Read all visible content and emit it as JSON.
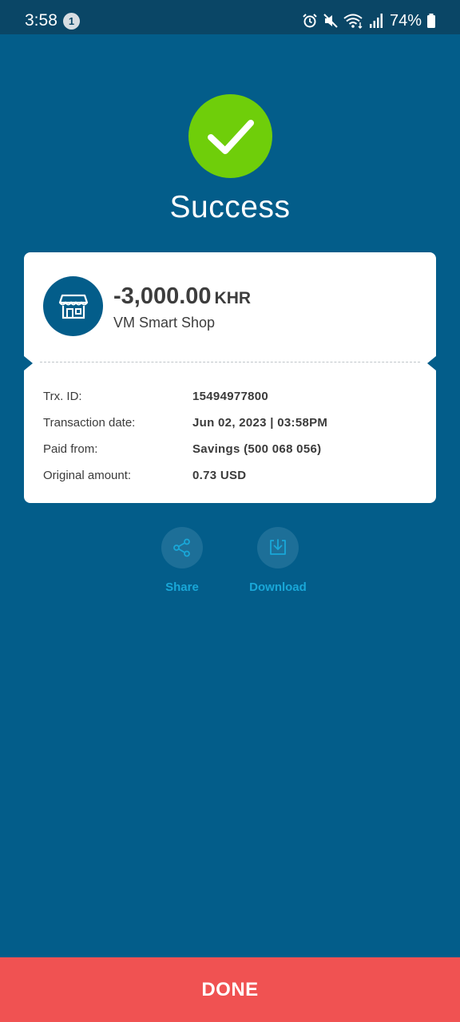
{
  "status_bar": {
    "time": "3:58",
    "notification_count": "1",
    "battery": "74%"
  },
  "result": {
    "title": "Success"
  },
  "transaction": {
    "amount": "-3,000.00",
    "currency": "KHR",
    "merchant": "VM Smart Shop",
    "details": [
      {
        "label": "Trx. ID:",
        "value": "15494977800"
      },
      {
        "label": "Transaction date:",
        "value": "Jun 02, 2023 | 03:58PM"
      },
      {
        "label": "Paid from:",
        "value": "Savings (500 068 056)"
      },
      {
        "label": "Original amount:",
        "value": "0.73 USD"
      }
    ]
  },
  "actions": {
    "share_label": "Share",
    "download_label": "Download"
  },
  "done_label": "DONE",
  "colors": {
    "background": "#035d8a",
    "success": "#6fce0a",
    "accent": "#19a7d8",
    "done": "#f05252"
  }
}
